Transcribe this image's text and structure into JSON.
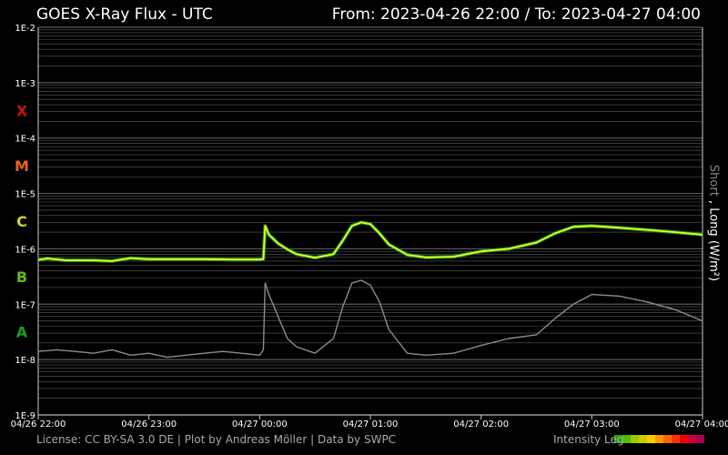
{
  "header": {
    "title": "GOES X-Ray Flux - UTC",
    "range": "From: 2023-04-26 22:00  /  To: 2023-04-27 04:00"
  },
  "footer": {
    "license": "License: CC BY-SA 3.0 DE | Plot by Andreas Möller | Data by SWPC",
    "legend_label": "Intensity Leg",
    "legend_colors": [
      "#22aa00",
      "#55bb00",
      "#99cc00",
      "#cccc00",
      "#ffcc00",
      "#ff9900",
      "#ff6600",
      "#ff3300",
      "#ee0000",
      "#cc0033",
      "#aa0055"
    ]
  },
  "side_label": {
    "short": "Short",
    "sep": " , ",
    "long": "Long (W/m²)"
  },
  "colors": {
    "long_series": "#e6ff2a",
    "long_series_fill": "#1f8a1f",
    "short_series": "#8c8c8c",
    "grid": "#5a5a5a",
    "class_X": "#cc1010",
    "class_M": "#e8641a",
    "class_C": "#d4d42a",
    "class_B": "#66b814",
    "class_A": "#1e9e1e"
  },
  "chart_data": {
    "type": "line",
    "title": "GOES X-Ray Flux - UTC",
    "ylabel": "Short , Long (W/m²)",
    "y_scale": "log",
    "ylim": [
      "1E-9",
      "1E-2"
    ],
    "y_ticks": [
      "1E-2",
      "1E-3",
      "1E-4",
      "1E-5",
      "1E-6",
      "1E-7",
      "1E-8",
      "1E-9"
    ],
    "flare_classes": [
      "X",
      "M",
      "C",
      "B",
      "A"
    ],
    "x_ticks": [
      "04/26 22:00",
      "04/26 23:00",
      "04/27 00:00",
      "04/27 01:00",
      "04/27 02:00",
      "04/27 03:00",
      "04/27 04:00"
    ],
    "xlim": [
      "2023-04-26 22:00",
      "2023-04-27 04:00"
    ],
    "grid": true,
    "series": [
      {
        "name": "Long",
        "x": [
          "2023-04-26 22:00",
          "2023-04-26 22:05",
          "2023-04-26 22:15",
          "2023-04-26 22:30",
          "2023-04-26 22:40",
          "2023-04-26 22:50",
          "2023-04-26 23:00",
          "2023-04-26 23:15",
          "2023-04-26 23:30",
          "2023-04-26 23:45",
          "2023-04-27 00:00",
          "2023-04-27 00:02",
          "2023-04-27 00:03",
          "2023-04-27 00:05",
          "2023-04-27 00:10",
          "2023-04-27 00:15",
          "2023-04-27 00:20",
          "2023-04-27 00:30",
          "2023-04-27 00:40",
          "2023-04-27 00:45",
          "2023-04-27 00:50",
          "2023-04-27 00:55",
          "2023-04-27 01:00",
          "2023-04-27 01:05",
          "2023-04-27 01:10",
          "2023-04-27 01:20",
          "2023-04-27 01:30",
          "2023-04-27 01:45",
          "2023-04-27 02:00",
          "2023-04-27 02:15",
          "2023-04-27 02:30",
          "2023-04-27 02:40",
          "2023-04-27 02:50",
          "2023-04-27 03:00",
          "2023-04-27 03:15",
          "2023-04-27 03:30",
          "2023-04-27 03:45",
          "2023-04-27 04:00"
        ],
        "y": [
          6.3e-07,
          6.7e-07,
          6.2e-07,
          6.2e-07,
          6e-07,
          6.8e-07,
          6.5e-07,
          6.5e-07,
          6.5e-07,
          6.4e-07,
          6.4e-07,
          6.5e-07,
          2.6e-06,
          1.8e-06,
          1.25e-06,
          9.8e-07,
          8e-07,
          6.9e-07,
          8e-07,
          1.4e-06,
          2.6e-06,
          3e-06,
          2.8e-06,
          1.9e-06,
          1.2e-06,
          7.8e-07,
          7e-07,
          7.2e-07,
          9e-07,
          1e-06,
          1.3e-06,
          1.9e-06,
          2.5e-06,
          2.6e-06,
          2.4e-06,
          2.2e-06,
          2e-06,
          1.8e-06
        ]
      },
      {
        "name": "Short",
        "x": [
          "2023-04-26 22:00",
          "2023-04-26 22:10",
          "2023-04-26 22:20",
          "2023-04-26 22:30",
          "2023-04-26 22:40",
          "2023-04-26 22:50",
          "2023-04-26 23:00",
          "2023-04-26 23:10",
          "2023-04-26 23:20",
          "2023-04-26 23:30",
          "2023-04-26 23:40",
          "2023-04-26 23:50",
          "2023-04-27 00:00",
          "2023-04-27 00:02",
          "2023-04-27 00:03",
          "2023-04-27 00:05",
          "2023-04-27 00:10",
          "2023-04-27 00:15",
          "2023-04-27 00:20",
          "2023-04-27 00:30",
          "2023-04-27 00:40",
          "2023-04-27 00:45",
          "2023-04-27 00:50",
          "2023-04-27 00:55",
          "2023-04-27 01:00",
          "2023-04-27 01:05",
          "2023-04-27 01:10",
          "2023-04-27 01:20",
          "2023-04-27 01:30",
          "2023-04-27 01:45",
          "2023-04-27 02:00",
          "2023-04-27 02:15",
          "2023-04-27 02:30",
          "2023-04-27 02:40",
          "2023-04-27 02:50",
          "2023-04-27 03:00",
          "2023-04-27 03:15",
          "2023-04-27 03:30",
          "2023-04-27 03:45",
          "2023-04-27 04:00"
        ],
        "y": [
          1.4e-08,
          1.5e-08,
          1.4e-08,
          1.3e-08,
          1.5e-08,
          1.2e-08,
          1.3e-08,
          1.1e-08,
          1.2e-08,
          1.3e-08,
          1.4e-08,
          1.3e-08,
          1.2e-08,
          1.5e-08,
          2.4e-07,
          1.5e-07,
          6e-08,
          2.4e-08,
          1.7e-08,
          1.3e-08,
          2.4e-08,
          9e-08,
          2.4e-07,
          2.7e-07,
          2.2e-07,
          1.1e-07,
          3.5e-08,
          1.3e-08,
          1.2e-08,
          1.3e-08,
          1.8e-08,
          2.4e-08,
          2.8e-08,
          5.5e-08,
          1e-07,
          1.5e-07,
          1.4e-07,
          1.1e-07,
          8e-08,
          5e-08
        ]
      }
    ]
  }
}
